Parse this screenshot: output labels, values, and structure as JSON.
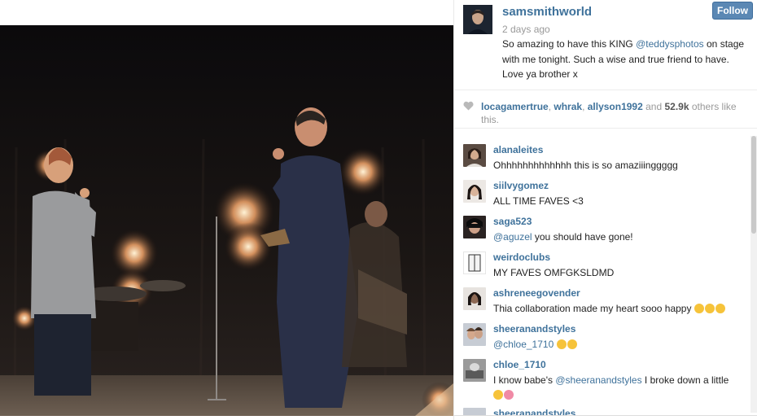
{
  "post": {
    "username": "samsmithworld",
    "follow_label": "Follow",
    "time": "2 days ago",
    "caption_pre": "So amazing to have this KING ",
    "caption_mention": "@teddysphotos",
    "caption_post": " on stage with me tonight. Such a wise and true friend to have. Love ya brother x"
  },
  "likes": {
    "user1": "locagamertrue",
    "user2": "whrak",
    "user3": "allyson1992",
    "and": "and",
    "count": "52.9k",
    "suffix": "others like this."
  },
  "comments": [
    {
      "user": "alanaleites",
      "text": "Ohhhhhhhhhhhhh this is so amaziiinggggg"
    },
    {
      "user": "siilvygomez",
      "text": "ALL TIME FAVES <3"
    },
    {
      "user": "saga523",
      "mention": "@aguzel",
      "text": " you should have gone!"
    },
    {
      "user": "weirdoclubs",
      "text": "MY FAVES OMFGKSLDMD"
    },
    {
      "user": "ashreneegovender",
      "text": "Thia collaboration made my heart sooo happy"
    },
    {
      "user": "sheeranandstyles",
      "mention": "@chloe_1710",
      "text": ""
    },
    {
      "user": "chloe_1710",
      "text_pre": "I know babe's ",
      "mention": "@sheeranandstyles",
      "text_post": " I broke down a little"
    },
    {
      "user": "sheeranandstyles"
    }
  ],
  "colors": {
    "link": "#3f729b",
    "follow": "#5b88b4"
  }
}
